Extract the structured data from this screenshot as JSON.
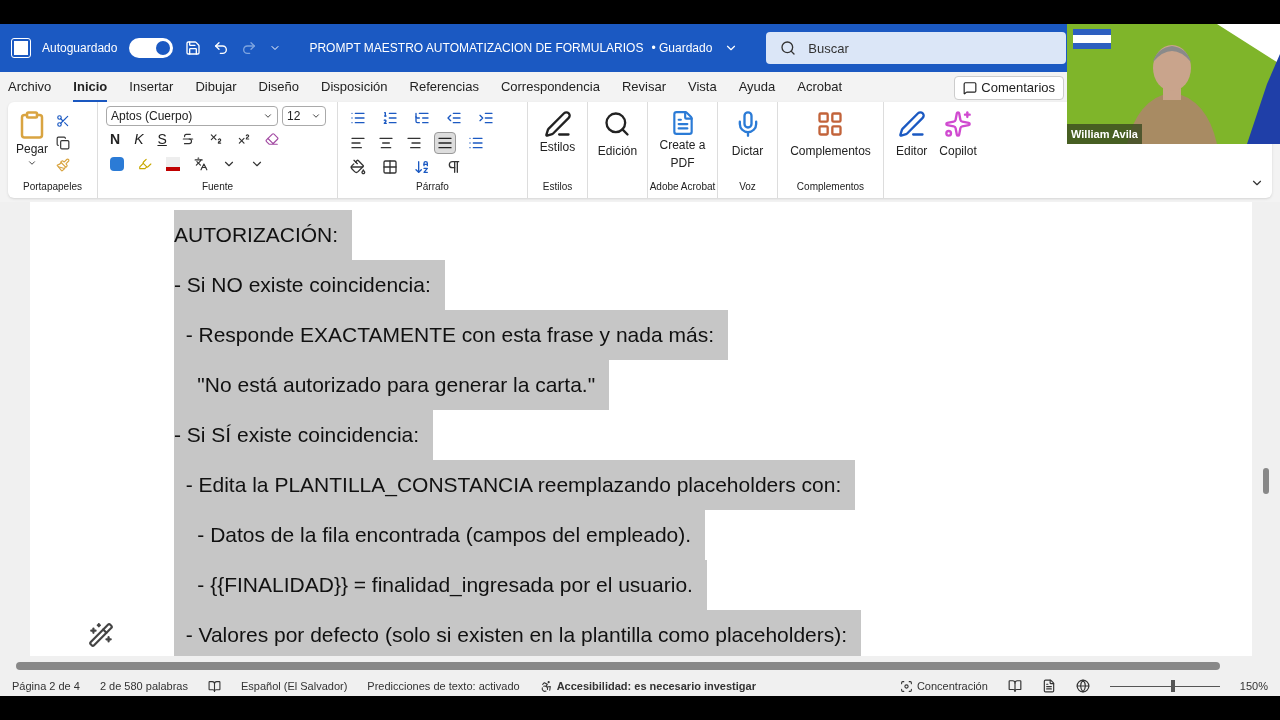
{
  "titlebar": {
    "autosave_label": "Autoguardado",
    "autosave_on": true,
    "title": "PROMPT MAESTRO AUTOMATIZACION DE FORMULARIOS",
    "save_state": "• Guardado",
    "search_placeholder": "Buscar"
  },
  "menu_tabs": [
    {
      "label": "Archivo",
      "selected": false
    },
    {
      "label": "Inicio",
      "selected": true
    },
    {
      "label": "Insertar",
      "selected": false
    },
    {
      "label": "Dibujar",
      "selected": false
    },
    {
      "label": "Diseño",
      "selected": false
    },
    {
      "label": "Disposición",
      "selected": false
    },
    {
      "label": "Referencias",
      "selected": false
    },
    {
      "label": "Correspondencia",
      "selected": false
    },
    {
      "label": "Revisar",
      "selected": false
    },
    {
      "label": "Vista",
      "selected": false
    },
    {
      "label": "Ayuda",
      "selected": false
    },
    {
      "label": "Acrobat",
      "selected": false
    }
  ],
  "comments_button": "Comentarios",
  "ribbon": {
    "paste": "Pegar",
    "clipboard_group": "Portapapeles",
    "font_name": "Aptos (Cuerpo)",
    "font_size": "12",
    "bold": "N",
    "italic": "K",
    "underline": "S",
    "font_group": "Fuente",
    "paragraph_group": "Párrafo",
    "styles": "Estilos",
    "styles_group": "Estilos",
    "editing": "Edición",
    "create_pdf": "Create a PDF",
    "acrobat_group": "Adobe Acrobat",
    "dictate": "Dictar",
    "voice_group": "Voz",
    "addins": "Complementos",
    "addins_group": "Complementos",
    "editor": "Editor",
    "copilot": "Copilot",
    "justify_selected": true
  },
  "video": {
    "kind": "picture",
    "name": "William Avila"
  },
  "document": {
    "lines": [
      "AUTORIZACIÓN:",
      "- Si NO existe coincidencia:",
      "  - Responde EXACTAMENTE con esta frase y nada más:",
      "    \"No está autorizado para generar la carta.\"",
      "- Si SÍ existe coincidencia:",
      "  - Edita la PLANTILLA_CONSTANCIA reemplazando placeholders con:",
      "    - Datos de la fila encontrada (campos del empleado).",
      "    - {{FINALIDAD}} = finalidad_ingresada por el usuario.",
      "  - Valores por defecto (solo si existen en la plantilla como placeholders):"
    ]
  },
  "status_bar": {
    "page": "Página 2 de 4",
    "words": "2 de 580 palabras",
    "language": "Español (El Salvador)",
    "predictions": "Predicciones de texto: activado",
    "accessibility": "Accesibilidad: es necesario investigar",
    "focus": "Concentración",
    "zoom": "150%",
    "zoom_slider": {
      "level": 0.58
    }
  }
}
